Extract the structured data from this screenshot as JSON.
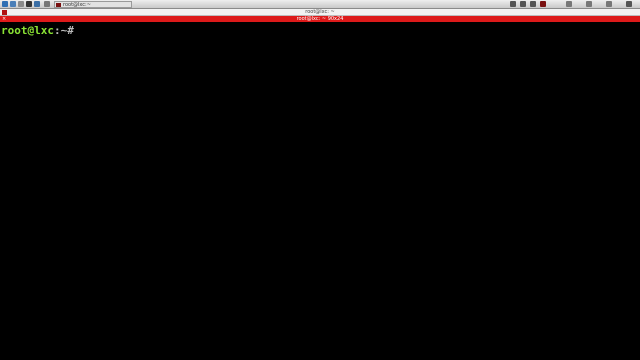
{
  "taskbar": {
    "launchers": [
      {
        "icon": "menu-icon",
        "color": "#2f6fb3"
      },
      {
        "icon": "desktop-icon",
        "color": "#4b7fb8"
      },
      {
        "icon": "file-manager-icon",
        "color": "#8a8a8a"
      },
      {
        "icon": "terminal-launcher-icon",
        "color": "#333333"
      },
      {
        "icon": "browser-icon",
        "color": "#3a6ea5"
      },
      {
        "icon": "window-list-icon",
        "color": "#777777"
      }
    ],
    "active_task": "root@lxc:~",
    "inactive_task": "",
    "tray": [
      {
        "icon": "tray-app-icon",
        "color": "#555555"
      },
      {
        "icon": "tray-app-icon",
        "color": "#555555"
      },
      {
        "icon": "tray-app-icon",
        "color": "#555555"
      },
      {
        "icon": "tray-app-icon",
        "color": "#7a1010"
      },
      {
        "icon": "tray-network-icon",
        "color": "#777777"
      },
      {
        "icon": "tray-volume-icon",
        "color": "#777777"
      },
      {
        "icon": "tray-window-icon",
        "color": "#777777"
      },
      {
        "icon": "tray-power-icon",
        "color": "#555555"
      }
    ]
  },
  "window": {
    "title": "root@lxc: ~"
  },
  "terminal": {
    "tab_title": "root@lxc: ~ 90x24",
    "tab_close": "×",
    "prompt_user": "root@lxc",
    "prompt_sep": ":",
    "prompt_path": "~#",
    "colors": {
      "tab_bar": "#dd1a1a",
      "prompt": "#8ae234",
      "background": "#000000"
    }
  }
}
